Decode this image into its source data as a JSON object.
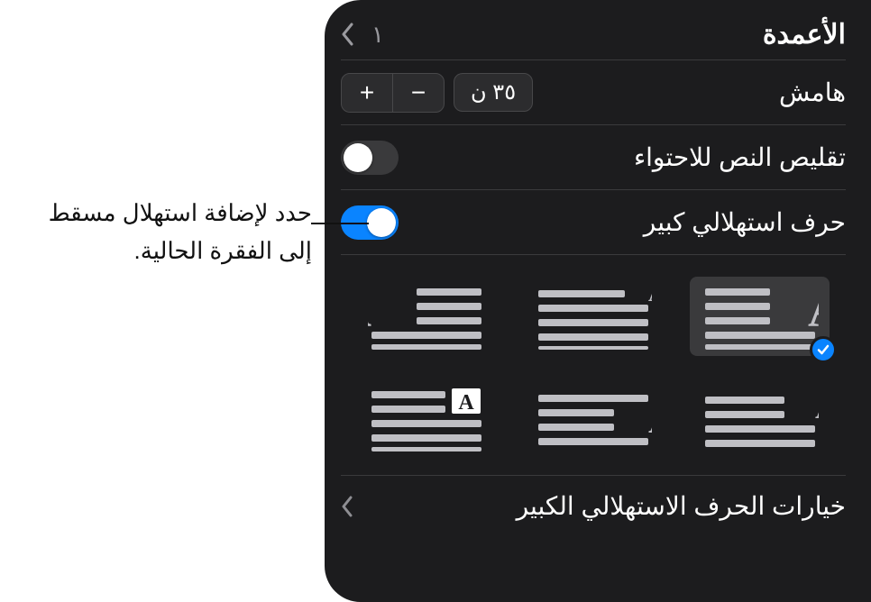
{
  "header": {
    "title": "الأعمدة",
    "columns_value": "١"
  },
  "margin": {
    "label": "هامش",
    "value": "٣٥ ن",
    "minus_label": "−",
    "plus_label": "+"
  },
  "shrink": {
    "label": "تقليص النص للاحتواء",
    "on": false
  },
  "dropcap": {
    "label": "حرف استهلالي كبير",
    "on": true,
    "options_label": "خيارات الحرف الاستهلالي الكبير",
    "styles": [
      {
        "id": "raised-right",
        "selected": true
      },
      {
        "id": "raised-center",
        "selected": false
      },
      {
        "id": "raised-left",
        "selected": false
      },
      {
        "id": "inline-right",
        "selected": false
      },
      {
        "id": "inline-baseline",
        "selected": false
      },
      {
        "id": "boxed",
        "selected": false
      }
    ]
  },
  "callout": {
    "text": "حدد لإضافة استهلال مسقط إلى الفقرة الحالية."
  }
}
